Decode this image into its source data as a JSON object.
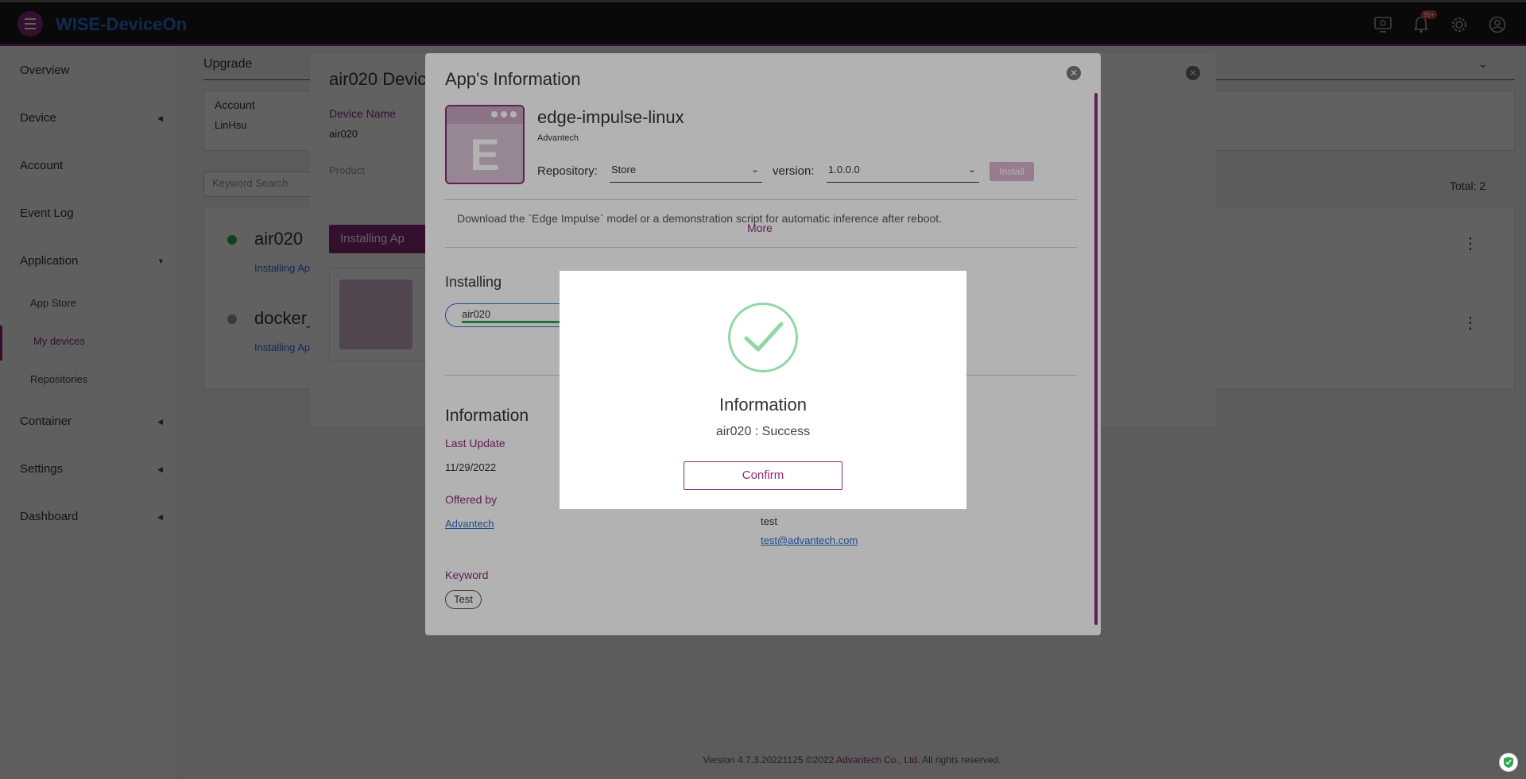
{
  "header": {
    "brand": "WISE-DeviceOn",
    "notification_badge": "99+"
  },
  "sidebar": {
    "items": [
      {
        "label": "Overview"
      },
      {
        "label": "Device"
      },
      {
        "label": "Account"
      },
      {
        "label": "Event Log"
      },
      {
        "label": "Application"
      },
      {
        "label": "Container"
      },
      {
        "label": "Settings"
      },
      {
        "label": "Dashboard"
      }
    ],
    "subitems": [
      {
        "label": "App Store"
      },
      {
        "label": "My devices"
      },
      {
        "label": "Repositories"
      }
    ]
  },
  "main": {
    "section_title": "Upgrade",
    "account_label": "Account",
    "account_value": "LinHsu",
    "search_placeholder": "Keyword Search",
    "total": "Total: 2",
    "devices": [
      {
        "name": "air020",
        "status": "Installing Ap"
      },
      {
        "name": "docker_",
        "status": "Installing Ap"
      }
    ],
    "footer_prefix": "Version 4.7.3.20221125 ©2022 ",
    "footer_company": "Advantech Co., Ltd.",
    "footer_suffix": " All rights reserved."
  },
  "device_dialog": {
    "title": "air020 Devic",
    "device_name_label": "Device Name",
    "device_name_value": "air020",
    "product_label": "Product",
    "installing_button": "Installing Ap"
  },
  "app_dialog": {
    "title": "App's Information",
    "icon_letter": "E",
    "app_name": "edge-impulse-linux",
    "vendor": "Advantech",
    "repository_label": "Repository:",
    "repository_value": "Store",
    "version_label": "version:",
    "version_value": "1.0.0.0",
    "install_button": "Install",
    "description": "Download the `Edge Impulse` model or a demonstration script for automatic inference after reboot.",
    "more_link": "More",
    "installing_title": "Installing",
    "installing_device": "air020",
    "installing_progress": 1.0,
    "information_title": "Information",
    "last_update_label": "Last Update",
    "last_update_value": "11/29/2022",
    "offered_by_label": "Offered by",
    "offered_by_value": "Advantech",
    "contact_name": "test",
    "contact_email": "test@advantech.com",
    "keyword_label": "Keyword",
    "keyword_chip": "Test"
  },
  "modal": {
    "title": "Information",
    "message": "air020 : Success",
    "confirm_button": "Confirm",
    "check_color": "#8fd8a5"
  }
}
